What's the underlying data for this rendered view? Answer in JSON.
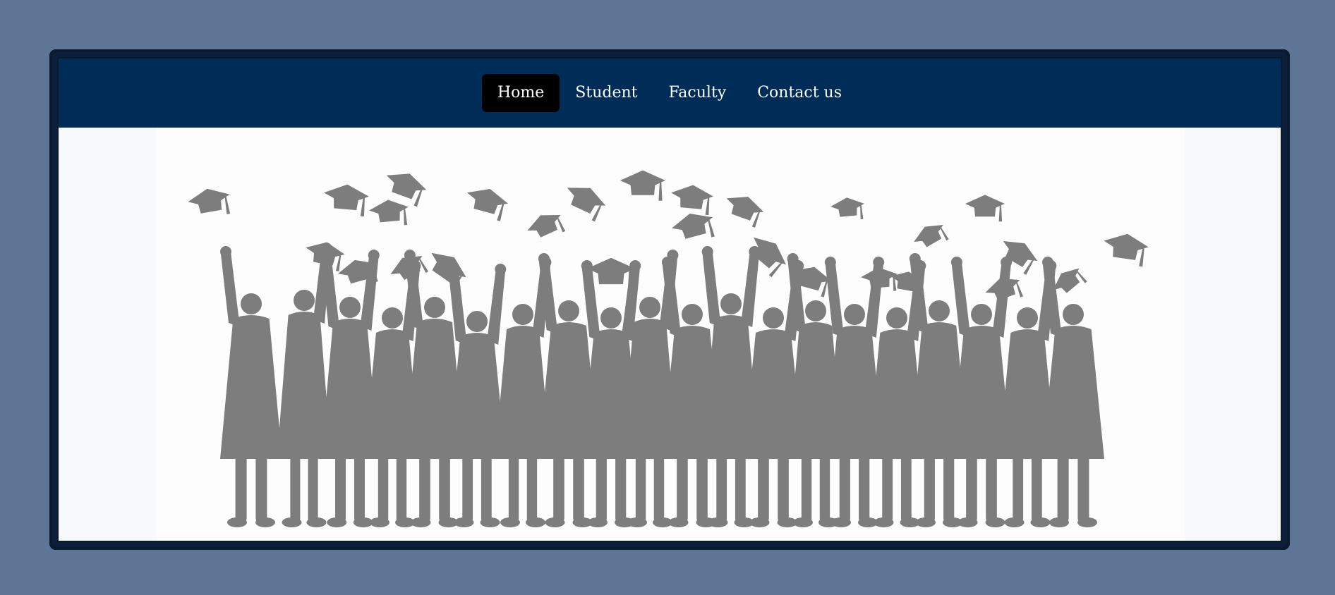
{
  "nav": {
    "items": [
      {
        "label": "Home",
        "active": true
      },
      {
        "label": "Student",
        "active": false
      },
      {
        "label": "Faculty",
        "active": false
      },
      {
        "label": "Contact us",
        "active": false
      }
    ]
  },
  "hero": {
    "image": "graduation-silhouette-illustration"
  },
  "colors": {
    "page_bg": "#5f7596",
    "navbar_bg": "#002d57",
    "active_bg": "#000000",
    "silhouette": "#7d7d7d"
  }
}
